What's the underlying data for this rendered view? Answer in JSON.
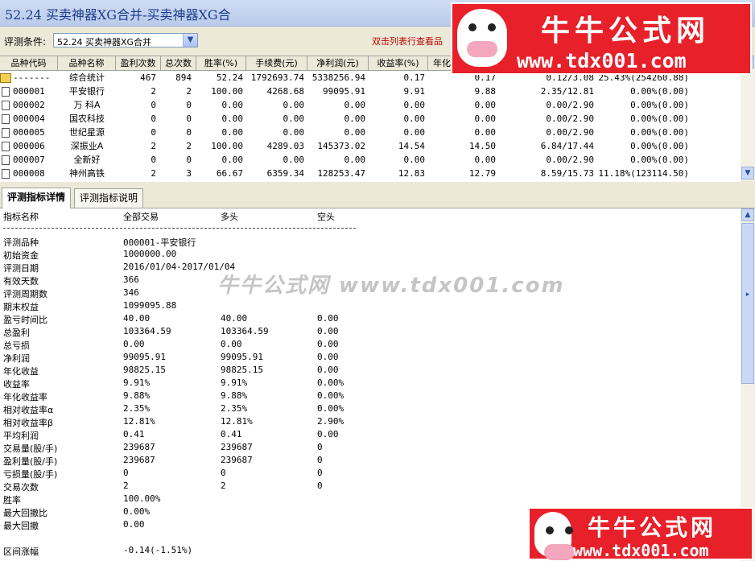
{
  "window": {
    "title": "52.24 买卖神器XG合并-买卖神器XG合"
  },
  "condition": {
    "label": "评测条件:",
    "value": "52.24 买卖神器XG合并",
    "hint": "双击列表行查看品"
  },
  "grid": {
    "columns": [
      "品种代码",
      "品种名称",
      "盈利次数",
      "总次数",
      "胜率(%)",
      "手续费(元)",
      "净利润(元)",
      "收益率(%)",
      "年化"
    ],
    "rows": [
      {
        "code": "-------",
        "name": "综合统计",
        "win": "467",
        "total": "894",
        "rate": "52.24",
        "fee": "1792693.74",
        "profit": "5338256.94",
        "ret": "0.17",
        "annual": "0.17",
        "extra1": "0.12/3.08",
        "extra2": "25.43%(254260.88)",
        "icon": "folder-icon"
      },
      {
        "code": "000001",
        "name": "平安银行",
        "win": "2",
        "total": "2",
        "rate": "100.00",
        "fee": "4268.68",
        "profit": "99095.91",
        "ret": "9.91",
        "annual": "9.88",
        "extra1": "2.35/12.81",
        "extra2": "0.00%(0.00)",
        "icon": "document-icon"
      },
      {
        "code": "000002",
        "name": "万 科A",
        "win": "0",
        "total": "0",
        "rate": "0.00",
        "fee": "0.00",
        "profit": "0.00",
        "ret": "0.00",
        "annual": "0.00",
        "extra1": "0.00/2.90",
        "extra2": "0.00%(0.00)",
        "icon": "document-icon"
      },
      {
        "code": "000004",
        "name": "国农科技",
        "win": "0",
        "total": "0",
        "rate": "0.00",
        "fee": "0.00",
        "profit": "0.00",
        "ret": "0.00",
        "annual": "0.00",
        "extra1": "0.00/2.90",
        "extra2": "0.00%(0.00)",
        "icon": "document-icon"
      },
      {
        "code": "000005",
        "name": "世纪星源",
        "win": "0",
        "total": "0",
        "rate": "0.00",
        "fee": "0.00",
        "profit": "0.00",
        "ret": "0.00",
        "annual": "0.00",
        "extra1": "0.00/2.90",
        "extra2": "0.00%(0.00)",
        "icon": "document-icon"
      },
      {
        "code": "000006",
        "name": "深振业A",
        "win": "2",
        "total": "2",
        "rate": "100.00",
        "fee": "4289.03",
        "profit": "145373.02",
        "ret": "14.54",
        "annual": "14.50",
        "extra1": "6.84/17.44",
        "extra2": "0.00%(0.00)",
        "icon": "document-icon"
      },
      {
        "code": "000007",
        "name": "全新好",
        "win": "0",
        "total": "0",
        "rate": "0.00",
        "fee": "0.00",
        "profit": "0.00",
        "ret": "0.00",
        "annual": "0.00",
        "extra1": "0.00/2.90",
        "extra2": "0.00%(0.00)",
        "icon": "document-icon"
      },
      {
        "code": "000008",
        "name": "神州高铁",
        "win": "2",
        "total": "3",
        "rate": "66.67",
        "fee": "6359.34",
        "profit": "128253.47",
        "ret": "12.83",
        "annual": "12.79",
        "extra1": "8.59/15.73",
        "extra2": "11.18%(123114.50)",
        "icon": "document-icon"
      }
    ]
  },
  "tabs": [
    {
      "label": "评测指标详情",
      "active": true
    },
    {
      "label": "评测指标说明",
      "active": false
    }
  ],
  "detail": {
    "header": {
      "name": "指标名称",
      "all": "全部交易",
      "long": "多头",
      "short": "空头"
    },
    "rows": [
      {
        "label": "评测品种",
        "all": "000001-平安银行",
        "long": "",
        "short": ""
      },
      {
        "label": "初始资金",
        "all": "1000000.00",
        "long": "",
        "short": ""
      },
      {
        "label": "评测日期",
        "all": "2016/01/04-2017/01/04",
        "long": "",
        "short": ""
      },
      {
        "label": "有效天数",
        "all": "366",
        "long": "",
        "short": ""
      },
      {
        "label": "评测周期数",
        "all": "346",
        "long": "",
        "short": ""
      },
      {
        "label": "期末权益",
        "all": "1099095.88",
        "long": "",
        "short": ""
      },
      {
        "label": "盈亏时间比",
        "all": "40.00",
        "long": "40.00",
        "short": "0.00"
      },
      {
        "label": "总盈利",
        "all": "103364.59",
        "long": "103364.59",
        "short": "0.00"
      },
      {
        "label": "总亏损",
        "all": "0.00",
        "long": "0.00",
        "short": "0.00"
      },
      {
        "label": "净利润",
        "all": "99095.91",
        "long": "99095.91",
        "short": "0.00"
      },
      {
        "label": "年化收益",
        "all": "98825.15",
        "long": "98825.15",
        "short": "0.00"
      },
      {
        "label": "收益率",
        "all": "9.91%",
        "long": "9.91%",
        "short": "0.00%"
      },
      {
        "label": "年化收益率",
        "all": "9.88%",
        "long": "9.88%",
        "short": "0.00%"
      },
      {
        "label": "相对收益率α",
        "all": "2.35%",
        "long": "2.35%",
        "short": "0.00%"
      },
      {
        "label": "相对收益率β",
        "all": "12.81%",
        "long": "12.81%",
        "short": "2.90%"
      },
      {
        "label": "平均利润",
        "all": "0.41",
        "long": "0.41",
        "short": "0.00"
      },
      {
        "label": "交易量(股/手)",
        "all": "239687",
        "long": "239687",
        "short": "0"
      },
      {
        "label": "盈利量(股/手)",
        "all": "239687",
        "long": "239687",
        "short": "0"
      },
      {
        "label": "亏损量(股/手)",
        "all": "0",
        "long": "0",
        "short": "0"
      },
      {
        "label": "交易次数",
        "all": "2",
        "long": "2",
        "short": "0"
      },
      {
        "label": "胜率",
        "all": "100.00%",
        "long": "",
        "short": ""
      },
      {
        "label": "最大回撤比",
        "all": "0.00%",
        "long": "",
        "short": ""
      },
      {
        "label": "最大回撤",
        "all": "0.00",
        "long": "",
        "short": ""
      },
      {
        "label": "",
        "all": "",
        "long": "",
        "short": ""
      },
      {
        "label": "区间涨幅",
        "all": "-0.14(-1.51%)",
        "long": "",
        "short": ""
      }
    ]
  },
  "watermark": {
    "brand": "牛牛公式网",
    "url": "www.tdx001.com",
    "center": "牛牛公式网 www.tdx001.com"
  },
  "colors": {
    "hint": "#c00000",
    "watermark_bg": "#e8202a"
  }
}
